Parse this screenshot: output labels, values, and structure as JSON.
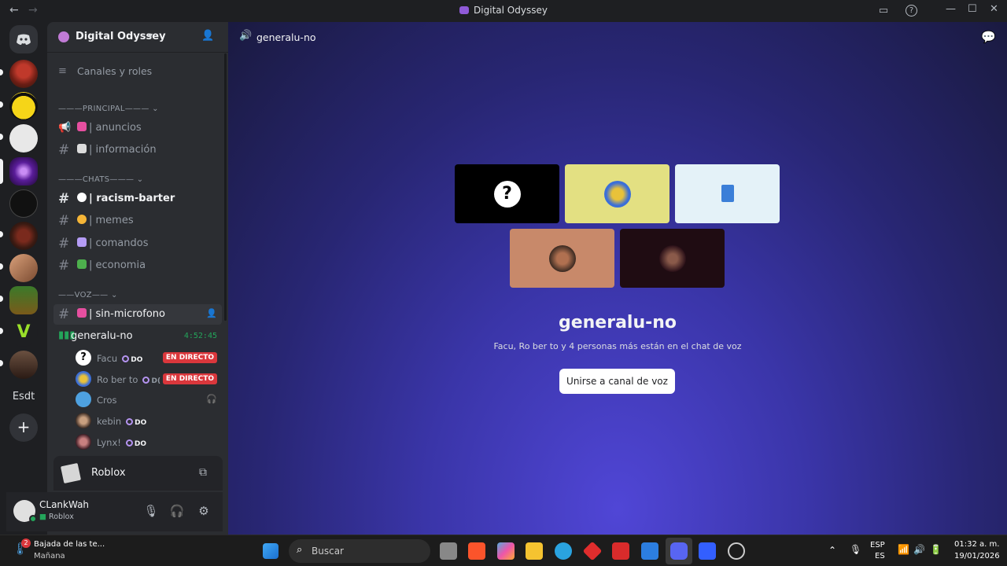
{
  "window": {
    "title": "Digital Odyssey",
    "back": "←",
    "forward": "→",
    "min": "—",
    "max": "☐",
    "close": "✕"
  },
  "server_list": {
    "dm_label": "Discord",
    "text_server": "Esdt",
    "add": "+"
  },
  "guild": {
    "name": "Digital Odyssey",
    "chevron": "▾",
    "browse": "Canales y roles"
  },
  "categories": {
    "principal": "———PRINCIPAL——— ⌄",
    "chats": "———CHATS——— ⌄",
    "voz": "——VOZ—— ⌄"
  },
  "channels": [
    {
      "label": "| anuncios",
      "emoji_color": "#e64fa0"
    },
    {
      "label": "| información",
      "emoji_color": "#dcdcdc"
    },
    {
      "label": "| racism-barter",
      "emoji_color": "#ffffff"
    },
    {
      "label": "| memes",
      "emoji_color": "#f5b537"
    },
    {
      "label": "| comandos",
      "emoji_color": "#b49cf5"
    },
    {
      "label": "| economia",
      "emoji_color": "#4db04d"
    },
    {
      "label": "| sin-microfono",
      "emoji_color": "#e64fa0"
    }
  ],
  "voice_channel": {
    "name": "generalu-no",
    "timer": "4:52:45"
  },
  "voice_users": [
    {
      "name": "Facu",
      "badge": "DO",
      "live": "EN DIRECTO",
      "color": "#ffffff"
    },
    {
      "name": "Ro ber to",
      "badge": "D(",
      "live": "EN DIRECTO",
      "color": "#3b6fd8"
    },
    {
      "name": "Cros",
      "badge": "",
      "live": "",
      "color": "#4ea1e0"
    },
    {
      "name": "kebin",
      "badge": "DO",
      "live": "",
      "color": "#7a4a3a"
    },
    {
      "name": "Lynx!",
      "badge": "DO",
      "live": "",
      "color": "#8a3a4a"
    }
  ],
  "activity": {
    "game": "Roblox"
  },
  "user": {
    "name": "CLankWah",
    "status": "Roblox"
  },
  "main": {
    "channel_name": "generalu-no",
    "title": "generalu-no",
    "subtitle": "Facu, Ro ber to y 4 personas más están en el chat de voz",
    "join_label": "Unirse a canal de voz",
    "tiles": [
      {
        "bg": "#000000",
        "avatar": "?"
      },
      {
        "bg": "#e3e082",
        "avatar": ""
      },
      {
        "bg": "#e4f2f8",
        "avatar": ""
      },
      {
        "bg": "#c8896a",
        "avatar": ""
      },
      {
        "bg": "#1f0c12",
        "avatar": ""
      }
    ]
  },
  "taskbar": {
    "weather_title": "Bajada de las te...",
    "weather_sub": "Mañana",
    "weather_badge": "2",
    "search_placeholder": "Buscar",
    "lang1": "ESP",
    "lang2": "ES",
    "time": "01:32 a. m.",
    "date": "19/01/2026"
  },
  "colors": {
    "accent": "#5865f2",
    "live": "#da373c",
    "sidebar": "#2b2d31",
    "rail": "#1e1f22"
  }
}
